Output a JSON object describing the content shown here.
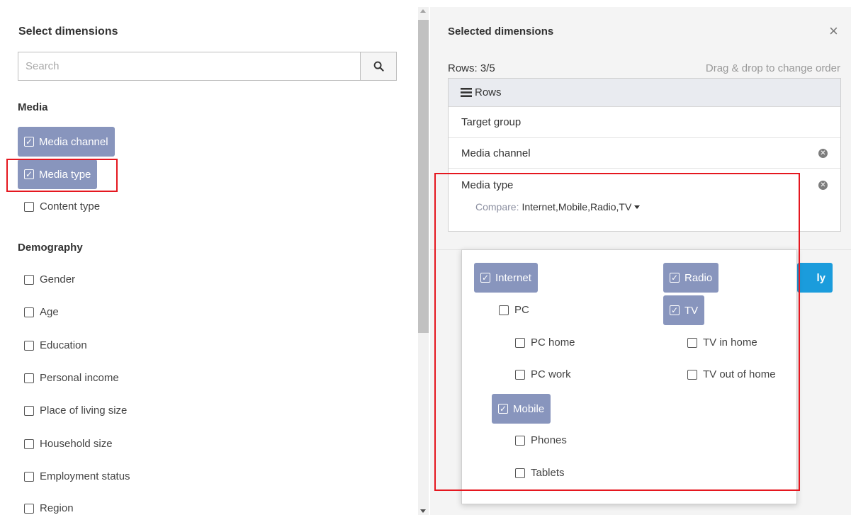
{
  "left": {
    "title": "Select dimensions",
    "search_placeholder": "Search",
    "sections": [
      {
        "title": "Media",
        "items": [
          {
            "label": "Media channel",
            "checked": true
          },
          {
            "label": "Media type",
            "checked": true
          },
          {
            "label": "Content type",
            "checked": false
          }
        ]
      },
      {
        "title": "Demography",
        "items": [
          {
            "label": "Gender",
            "checked": false
          },
          {
            "label": "Age",
            "checked": false
          },
          {
            "label": "Education",
            "checked": false
          },
          {
            "label": "Personal income",
            "checked": false
          },
          {
            "label": "Place of living size",
            "checked": false
          },
          {
            "label": "Household size",
            "checked": false
          },
          {
            "label": "Employment status",
            "checked": false
          },
          {
            "label": "Region",
            "checked": false
          }
        ]
      }
    ]
  },
  "right": {
    "title": "Selected dimensions",
    "close_glyph": "×",
    "rows_count": "Rows: 3/5",
    "drag_hint": "Drag & drop to change order",
    "rows_header": "Rows",
    "rows": [
      {
        "label": "Target group",
        "removable": false
      },
      {
        "label": "Media channel",
        "removable": true
      },
      {
        "label": "Media type",
        "removable": true
      }
    ],
    "compare_label": "Compare:",
    "compare_value": "Internet,Mobile,Radio,TV",
    "apply_fragment": "ly"
  },
  "dropdown": {
    "internet": "Internet",
    "pc": "PC",
    "pc_home": "PC home",
    "pc_work": "PC work",
    "mobile": "Mobile",
    "phones": "Phones",
    "tablets": "Tablets",
    "radio": "Radio",
    "tv": "TV",
    "tv_in_home": "TV in home",
    "tv_out_of_home": "TV out of home"
  },
  "icons": {
    "search": "search-icon",
    "close": "close-icon",
    "rows": "hamburger-icon",
    "remove": "remove-circle-icon",
    "caret": "caret-down-icon"
  },
  "colors": {
    "chip": "#8895bd",
    "accent": "#1b9cdc",
    "highlight": "#e5171f"
  }
}
